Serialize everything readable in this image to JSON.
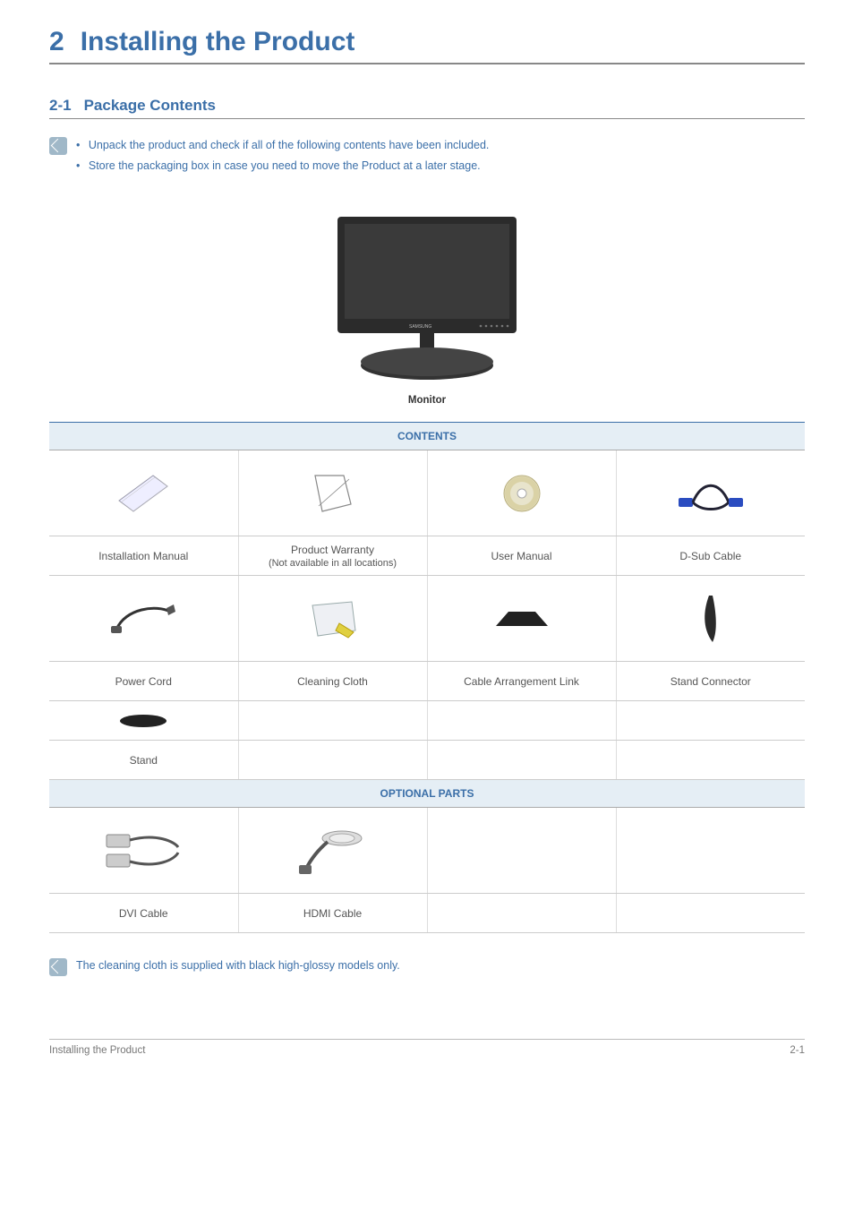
{
  "chapter": {
    "number": "2",
    "title": "Installing the Product"
  },
  "section": {
    "number": "2-1",
    "title": "Package Contents"
  },
  "notes1": {
    "items": [
      "Unpack the product and check if all of the following contents have been included.",
      "Store the packaging box in case you need to move the Product at a later stage."
    ]
  },
  "monitor_caption": "Monitor",
  "table": {
    "header_contents": "CONTENTS",
    "header_optional": "OPTIONAL PARTS",
    "row1": {
      "c1": "Installation Manual",
      "c2a": "Product Warranty",
      "c2b": "(Not available in all locations)",
      "c3": "User Manual",
      "c4": "D-Sub Cable"
    },
    "row2": {
      "c1": "Power Cord",
      "c2": "Cleaning Cloth",
      "c3": "Cable Arrangement Link",
      "c4": "Stand Connector"
    },
    "row3": {
      "c1": "Stand"
    },
    "row4": {
      "c1": "DVI Cable",
      "c2": "HDMI Cable"
    }
  },
  "note2": "The cleaning cloth is supplied with black high-glossy models only.",
  "footer": {
    "left": "Installing the Product",
    "right": "2-1"
  }
}
